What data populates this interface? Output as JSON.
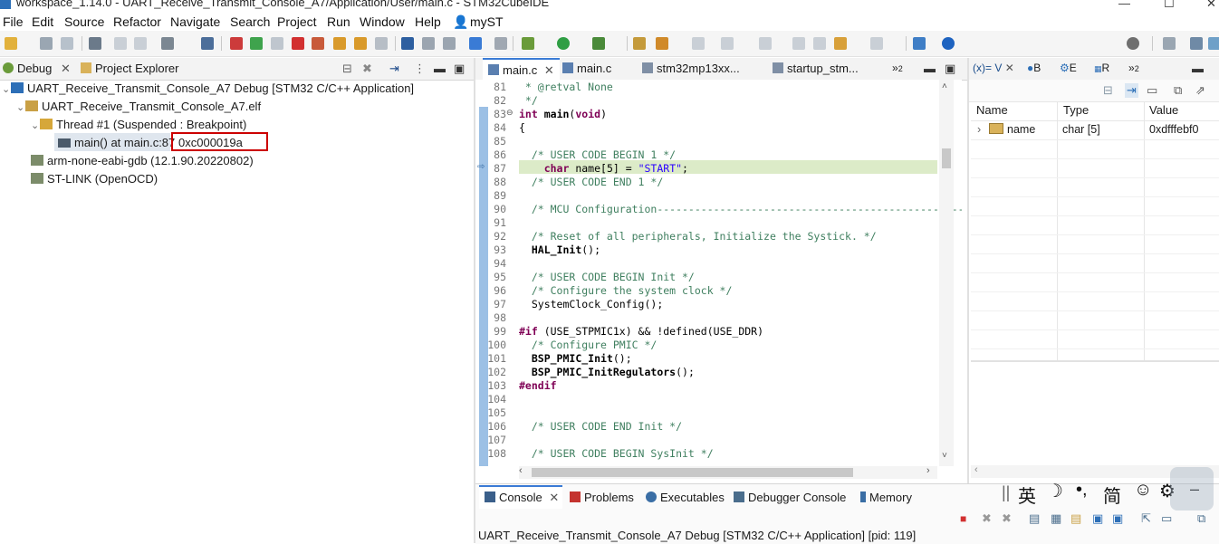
{
  "window": {
    "title": "workspace_1.14.0 - UART_Receive_Transmit_Console_A7/Application/User/main.c - STM32CubeIDE"
  },
  "menu": [
    "File",
    "Edit",
    "Source",
    "Refactor",
    "Navigate",
    "Search",
    "Project",
    "Run",
    "Window",
    "Help"
  ],
  "user": "myST",
  "debug_panel": {
    "tabs": [
      "Debug",
      "Project Explorer"
    ],
    "tree": [
      {
        "label": "UART_Receive_Transmit_Console_A7 Debug [STM32 C/C++ Application]",
        "icon": "ide-launch-icon"
      },
      {
        "label": "UART_Receive_Transmit_Console_A7.elf",
        "icon": "elf-process-icon"
      },
      {
        "label": "Thread #1 (Suspended : Breakpoint)",
        "icon": "thread-icon"
      },
      {
        "label": "main() at main.c:87",
        "address": "0xc000019a",
        "icon": "stack-frame-icon"
      },
      {
        "label": "arm-none-eabi-gdb (12.1.90.20220802)",
        "icon": "gdb-icon"
      },
      {
        "label": "ST-LINK (OpenOCD)",
        "icon": "stlink-icon"
      }
    ]
  },
  "editor": {
    "tabs": [
      "main.c",
      "main.c",
      "stm32mp13xx...",
      "startup_stm...",
      "2"
    ],
    "lines": [
      {
        "n": "81",
        "text": " * @retval None",
        "cls": "cmt"
      },
      {
        "n": "82",
        "text": " */",
        "cls": "cmt"
      },
      {
        "n": "83",
        "text": "int main(void)",
        "cls": "sig"
      },
      {
        "n": "84",
        "text": "{",
        "cls": ""
      },
      {
        "n": "85",
        "text": "",
        "cls": ""
      },
      {
        "n": "86",
        "text": "  /* USER CODE BEGIN 1 */",
        "cls": "cmt"
      },
      {
        "n": "87",
        "text": "    char name[5] = \"START\";",
        "cls": "cur"
      },
      {
        "n": "88",
        "text": "  /* USER CODE END 1 */",
        "cls": "cmt"
      },
      {
        "n": "89",
        "text": "",
        "cls": ""
      },
      {
        "n": "90",
        "text": "  /* MCU Configuration--------------------------------------------------------",
        "cls": "cmt"
      },
      {
        "n": "91",
        "text": "",
        "cls": ""
      },
      {
        "n": "92",
        "text": "  /* Reset of all peripherals, Initialize the Systick. */",
        "cls": "cmt"
      },
      {
        "n": "93",
        "text": "  HAL_Init();",
        "cls": "call"
      },
      {
        "n": "94",
        "text": "",
        "cls": ""
      },
      {
        "n": "95",
        "text": "  /* USER CODE BEGIN Init */",
        "cls": "cmt"
      },
      {
        "n": "96",
        "text": "  /* Configure the system clock */",
        "cls": "cmt"
      },
      {
        "n": "97",
        "text": "  SystemClock_Config();",
        "cls": ""
      },
      {
        "n": "98",
        "text": "",
        "cls": ""
      },
      {
        "n": "99",
        "text": "#if (USE_STPMIC1x) && !defined(USE_DDR)",
        "cls": "pp"
      },
      {
        "n": "100",
        "text": "  /* Configure PMIC */",
        "cls": "cmt"
      },
      {
        "n": "101",
        "text": "  BSP_PMIC_Init();",
        "cls": "call"
      },
      {
        "n": "102",
        "text": "  BSP_PMIC_InitRegulators();",
        "cls": "call"
      },
      {
        "n": "103",
        "text": "#endif",
        "cls": "pp"
      },
      {
        "n": "104",
        "text": "",
        "cls": ""
      },
      {
        "n": "105",
        "text": "",
        "cls": ""
      },
      {
        "n": "106",
        "text": "  /* USER CODE END Init */",
        "cls": "cmt"
      },
      {
        "n": "107",
        "text": "",
        "cls": ""
      },
      {
        "n": "108",
        "text": "  /* USER CODE BEGIN SysInit */",
        "cls": "cmt"
      }
    ]
  },
  "variables": {
    "tabs": [
      "(x)= V",
      "B",
      "E",
      "R",
      "2"
    ],
    "columns": [
      "Name",
      "Type",
      "Value"
    ],
    "rows": [
      {
        "name": "name",
        "type": "char [5]",
        "value": "0xdfffebf0"
      }
    ]
  },
  "bottom": {
    "tabs": [
      "Console",
      "Problems",
      "Executables",
      "Debugger Console",
      "Memory"
    ],
    "status": "UART_Receive_Transmit_Console_A7 Debug [STM32 C/C++ Application]  [pid: 119]",
    "ime": [
      "英",
      "简"
    ]
  },
  "colors": {
    "highlight_line": "#dcebc8",
    "ide_blue": "#2d6fb7",
    "callout_red": "#cc0000"
  }
}
